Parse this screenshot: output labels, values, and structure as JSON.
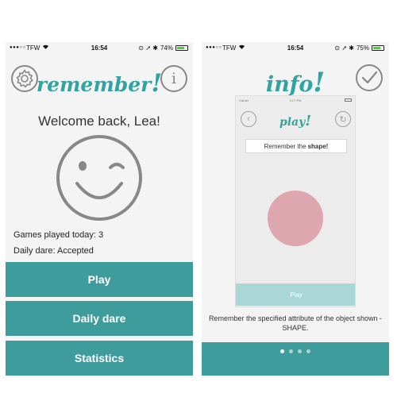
{
  "left_screen": {
    "status_bar": {
      "signal": "●●●○○",
      "carrier": "TFW",
      "wifi_icon": "wifi-icon",
      "time": "16:54",
      "icons": "⊙ ➚ ✱",
      "battery_percent": "74%",
      "battery_level": 0.74
    },
    "header": {
      "logo_text": "remember",
      "logo_mark": "!",
      "settings_icon": "gear-icon",
      "info_icon": "info-icon",
      "info_glyph": "i"
    },
    "welcome_text": "Welcome back, Lea!",
    "avatar_icon": "winking-face-icon",
    "stats": {
      "games_label": "Games played today:",
      "games_value": "3",
      "dare_label": "Daily dare:",
      "dare_value": "Accepted"
    },
    "menu": {
      "play_label": "Play",
      "daily_dare_label": "Daily dare",
      "statistics_label": "Statistics"
    }
  },
  "right_screen": {
    "status_bar": {
      "signal": "●●●○○",
      "carrier": "TFW",
      "wifi_icon": "wifi-icon",
      "time": "16:54",
      "icons": "⊙ ➚ ✱",
      "battery_percent": "75%",
      "battery_level": 0.75
    },
    "header": {
      "logo_text": "info",
      "logo_mark": "!",
      "done_icon": "checkmark-icon"
    },
    "preview": {
      "status": {
        "carrier": "Carrier",
        "time": "3:27 PM"
      },
      "back_icon": "chevron-left-icon",
      "back_glyph": "‹",
      "title_text": "play",
      "title_mark": "!",
      "refresh_icon": "refresh-icon",
      "refresh_glyph": "↻",
      "prompt_text": "Remember the",
      "prompt_bold": "shape!",
      "shape_color": "#dea6af",
      "play_label": "Play"
    },
    "caption": "Remember the specified attribute of the object shown - SHAPE.",
    "pagination": {
      "total": 4,
      "active_index": 0
    }
  },
  "colors": {
    "accent": "#3e9d9c",
    "accent_light": "#a9d7d6",
    "logo": "#31a3a0",
    "shape": "#dea6af"
  }
}
